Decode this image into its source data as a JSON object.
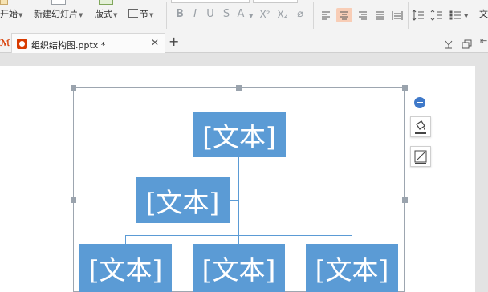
{
  "ribbon": {
    "start_label": "开始",
    "new_slide_label": "新建幻灯片",
    "layout_label": "版式",
    "section_label": "节",
    "format_buttons": [
      "B",
      "I",
      "U",
      "S",
      "A",
      "X²",
      "X₂"
    ],
    "text_label": "文"
  },
  "tab": {
    "title": "组织结构图.pptx *",
    "close_label": "✕",
    "add_label": "+"
  },
  "orgchart": {
    "top_text": "[文本]",
    "assistant_text": "[文本]",
    "child1_text": "[文本]",
    "child2_text": "[文本]",
    "child3_text": "[文本]"
  },
  "colors": {
    "node": "#5b9bd5",
    "active_align": "#f8cdb6",
    "accent_icon": "#d83b01",
    "minus_button": "#3f79c9"
  },
  "icons": [
    "paste-icon",
    "new-slide-icon",
    "layout-icon",
    "section-icon",
    "clear-format-icon",
    "align-left-icon",
    "align-center-icon",
    "align-right-icon",
    "justify-icon",
    "distributed-icon",
    "line-spacing-icon",
    "paragraph-spacing-icon",
    "bullets-icon",
    "presentation-file-icon",
    "collapse-icon",
    "mic-icon",
    "restore-icon",
    "minus-circle-icon",
    "fill-bucket-icon",
    "line-style-icon"
  ]
}
